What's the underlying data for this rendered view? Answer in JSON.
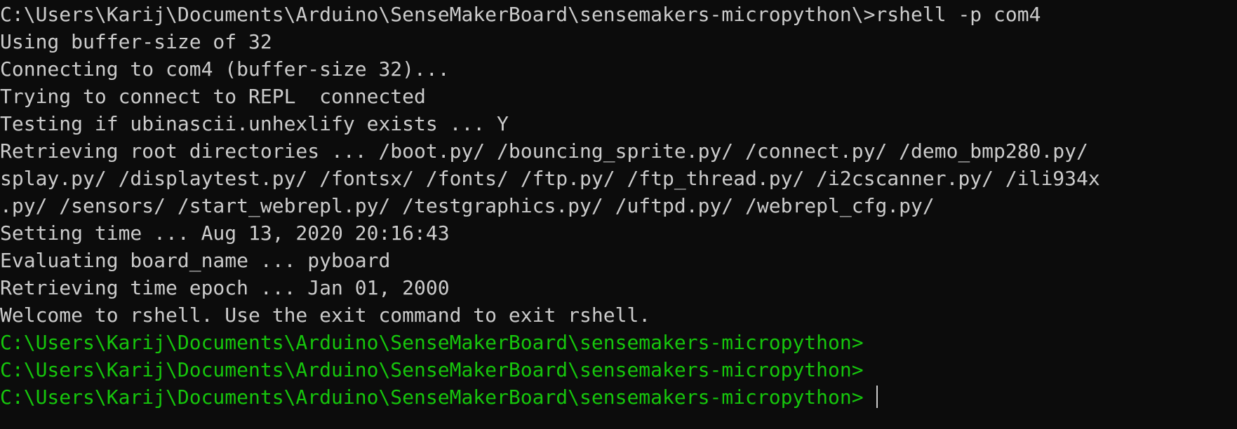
{
  "terminal": {
    "colors": {
      "background": "#0c0c0c",
      "text": "#cccccc",
      "prompt": "#16c60c"
    },
    "lines": [
      {
        "text": "C:\\Users\\Karij\\Documents\\Arduino\\SenseMakerBoard\\sensemakers-micropython\\>rshell -p com4",
        "style": "output"
      },
      {
        "text": "Using buffer-size of 32",
        "style": "output"
      },
      {
        "text": "Connecting to com4 (buffer-size 32)...",
        "style": "output"
      },
      {
        "text": "Trying to connect to REPL  connected",
        "style": "output"
      },
      {
        "text": "Testing if ubinascii.unhexlify exists ... Y",
        "style": "output"
      },
      {
        "text": "Retrieving root directories ... /boot.py/ /bouncing_sprite.py/ /connect.py/ /demo_bmp280.py/",
        "style": "output"
      },
      {
        "text": "splay.py/ /displaytest.py/ /fontsx/ /fonts/ /ftp.py/ /ftp_thread.py/ /i2cscanner.py/ /ili934x",
        "style": "output"
      },
      {
        "text": ".py/ /sensors/ /start_webrepl.py/ /testgraphics.py/ /uftpd.py/ /webrepl_cfg.py/",
        "style": "output"
      },
      {
        "text": "Setting time ... Aug 13, 2020 20:16:43",
        "style": "output"
      },
      {
        "text": "Evaluating board_name ... pyboard",
        "style": "output"
      },
      {
        "text": "Retrieving time epoch ... Jan 01, 2000",
        "style": "output"
      },
      {
        "text": "Welcome to rshell. Use the exit command to exit rshell.",
        "style": "output"
      },
      {
        "text": "C:\\Users\\Karij\\Documents\\Arduino\\SenseMakerBoard\\sensemakers-micropython>",
        "style": "prompt"
      },
      {
        "text": "C:\\Users\\Karij\\Documents\\Arduino\\SenseMakerBoard\\sensemakers-micropython>",
        "style": "prompt"
      },
      {
        "text": "C:\\Users\\Karij\\Documents\\Arduino\\SenseMakerBoard\\sensemakers-micropython> ",
        "style": "prompt"
      }
    ]
  }
}
